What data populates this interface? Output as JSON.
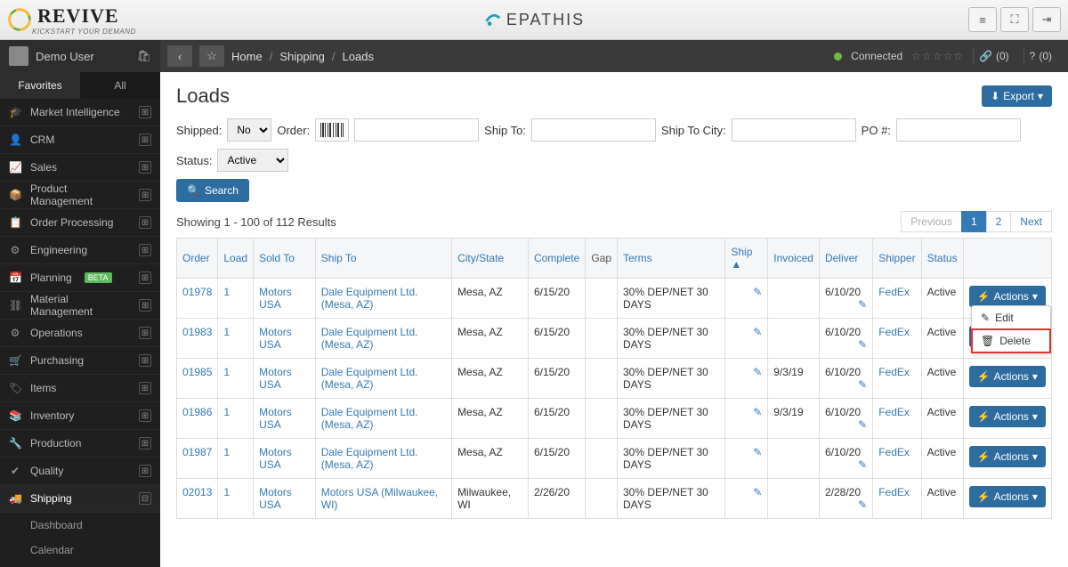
{
  "brand": {
    "name": "REVIVE",
    "tagline": "KICKSTART YOUR DEMAND",
    "center_brand": "EPATHIS"
  },
  "user": {
    "name": "Demo User"
  },
  "breadcrumb": {
    "home": "Home",
    "section": "Shipping",
    "page": "Loads"
  },
  "status_bar": {
    "connected": "Connected",
    "links_count": "(0)",
    "help_count": "(0)"
  },
  "sidebar": {
    "tabs": {
      "favorites": "Favorites",
      "all": "All"
    },
    "items": [
      {
        "label": "Market Intelligence"
      },
      {
        "label": "CRM"
      },
      {
        "label": "Sales"
      },
      {
        "label": "Product Management"
      },
      {
        "label": "Order Processing"
      },
      {
        "label": "Engineering"
      },
      {
        "label": "Planning",
        "badge": "BETA"
      },
      {
        "label": "Material Management"
      },
      {
        "label": "Operations"
      },
      {
        "label": "Purchasing"
      },
      {
        "label": "Items"
      },
      {
        "label": "Inventory"
      },
      {
        "label": "Production"
      },
      {
        "label": "Quality"
      },
      {
        "label": "Shipping",
        "current": true
      }
    ],
    "subitems": [
      {
        "label": "Dashboard"
      },
      {
        "label": "Calendar"
      }
    ]
  },
  "page": {
    "title": "Loads",
    "export": "Export"
  },
  "filters": {
    "shipped_label": "Shipped:",
    "shipped_value": "No",
    "order_label": "Order:",
    "shipto_label": "Ship To:",
    "shipcity_label": "Ship To City:",
    "po_label": "PO #:",
    "status_label": "Status:",
    "status_value": "Active",
    "search": "Search"
  },
  "results": {
    "text": "Showing 1 - 100 of 112 Results",
    "prev": "Previous",
    "next": "Next",
    "page1": "1",
    "page2": "2"
  },
  "columns": {
    "order": "Order",
    "load": "Load",
    "soldto": "Sold To",
    "shipto": "Ship To",
    "citystate": "City/State",
    "complete": "Complete",
    "gap": "Gap",
    "terms": "Terms",
    "ship": "Ship",
    "invoiced": "Invoiced",
    "deliver": "Deliver",
    "shipper": "Shipper",
    "status": "Status"
  },
  "actions_label": "Actions",
  "dropdown": {
    "edit": "Edit",
    "delete": "Delete"
  },
  "rows": [
    {
      "order": "01978",
      "load": "1",
      "soldto": "Motors USA",
      "shipto": "Dale Equipment Ltd. (Mesa, AZ)",
      "citystate": "Mesa, AZ",
      "complete": "6/15/20",
      "terms": "30% DEP/NET 30 DAYS",
      "ship": "",
      "invoiced": "",
      "deliver": "6/10/20",
      "shipper": "FedEx",
      "status": "Active"
    },
    {
      "order": "01983",
      "load": "1",
      "soldto": "Motors USA",
      "shipto": "Dale Equipment Ltd. (Mesa, AZ)",
      "citystate": "Mesa, AZ",
      "complete": "6/15/20",
      "terms": "30% DEP/NET 30 DAYS",
      "ship": "",
      "invoiced": "",
      "deliver": "6/10/20",
      "shipper": "FedEx",
      "status": "Active"
    },
    {
      "order": "01985",
      "load": "1",
      "soldto": "Motors USA",
      "shipto": "Dale Equipment Ltd. (Mesa, AZ)",
      "citystate": "Mesa, AZ",
      "complete": "6/15/20",
      "terms": "30% DEP/NET 30 DAYS",
      "ship": "",
      "invoiced": "9/3/19",
      "deliver": "6/10/20",
      "shipper": "FedEx",
      "status": "Active"
    },
    {
      "order": "01986",
      "load": "1",
      "soldto": "Motors USA",
      "shipto": "Dale Equipment Ltd. (Mesa, AZ)",
      "citystate": "Mesa, AZ",
      "complete": "6/15/20",
      "terms": "30% DEP/NET 30 DAYS",
      "ship": "",
      "invoiced": "9/3/19",
      "deliver": "6/10/20",
      "shipper": "FedEx",
      "status": "Active"
    },
    {
      "order": "01987",
      "load": "1",
      "soldto": "Motors USA",
      "shipto": "Dale Equipment Ltd. (Mesa, AZ)",
      "citystate": "Mesa, AZ",
      "complete": "6/15/20",
      "terms": "30% DEP/NET 30 DAYS",
      "ship": "",
      "invoiced": "",
      "deliver": "6/10/20",
      "shipper": "FedEx",
      "status": "Active"
    },
    {
      "order": "02013",
      "load": "1",
      "soldto": "Motors USA",
      "shipto": "Motors USA (Milwaukee, WI)",
      "citystate": "Milwaukee, WI",
      "complete": "2/26/20",
      "terms": "30% DEP/NET 30 DAYS",
      "ship": "",
      "invoiced": "",
      "deliver": "2/28/20",
      "shipper": "FedEx",
      "status": "Active"
    }
  ]
}
